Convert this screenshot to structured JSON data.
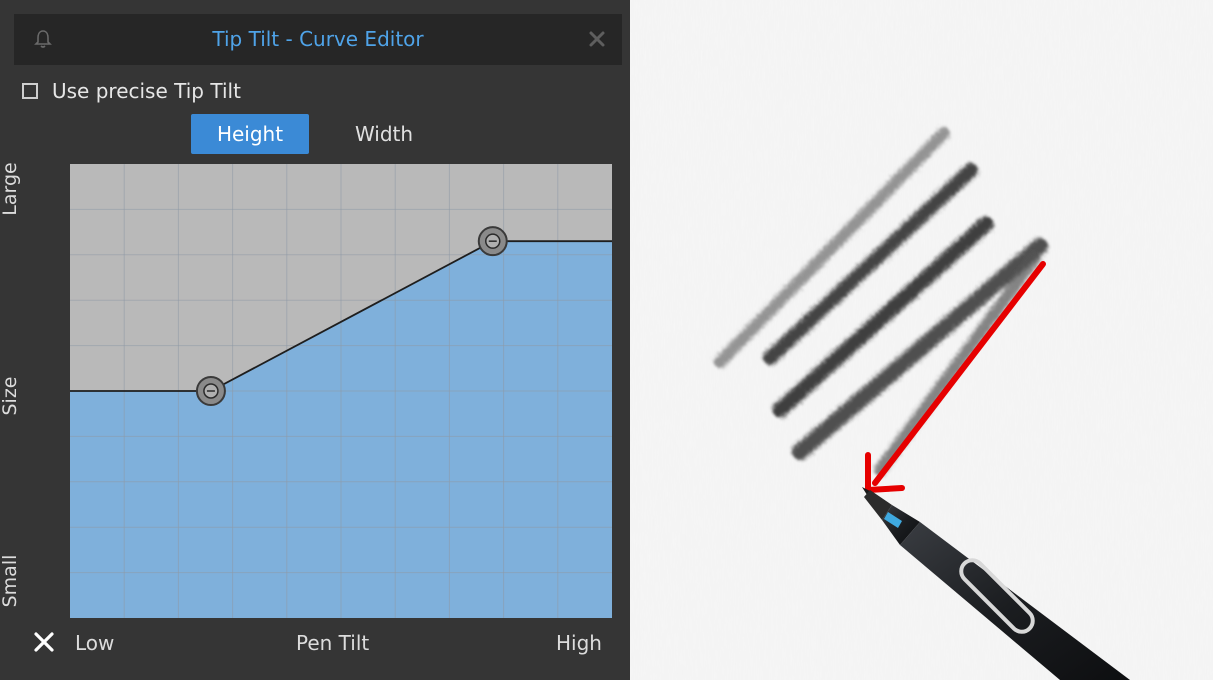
{
  "panel": {
    "title": "Tip Tilt - Curve Editor",
    "pin_icon": "bell-pin-icon",
    "close_icon": "close-icon",
    "precise_checkbox": {
      "label": "Use precise Tip Tilt",
      "checked": false
    },
    "tabs": [
      {
        "label": "Height",
        "active": true
      },
      {
        "label": "Width",
        "active": false
      }
    ],
    "y_axis": {
      "top": "Large",
      "middle": "Size",
      "bottom": "Small"
    },
    "x_axis": {
      "left": "Low",
      "center": "Pen Tilt",
      "right": "High"
    },
    "reset_icon": "x-reset-icon",
    "curve": {
      "points": [
        {
          "x": 0.0,
          "y": 0.5
        },
        {
          "x": 0.26,
          "y": 0.5
        },
        {
          "x": 0.78,
          "y": 0.83
        },
        {
          "x": 1.0,
          "y": 0.83
        }
      ],
      "fill_color": "#7fb0db",
      "background_color": "#b9b9b9"
    },
    "accent_color": "#3b8ad6"
  },
  "canvas": {
    "description_icon": "pencil-strokes-with-stylus",
    "arrow_color": "#e60000"
  }
}
